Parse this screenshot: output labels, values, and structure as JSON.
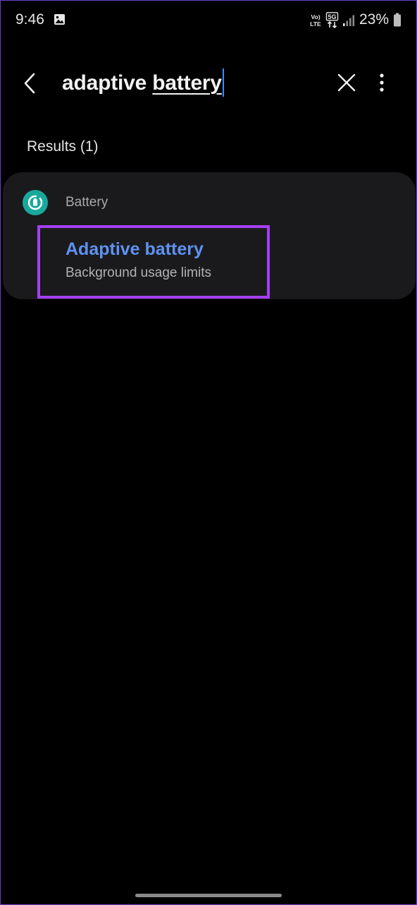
{
  "status_bar": {
    "time": "9:46",
    "gallery_icon": "image-icon",
    "volte_label": "Vo)) LTE",
    "network_label": "5G",
    "battery_percent": "23%"
  },
  "search": {
    "query_prefix": "adaptive ",
    "query_word": "battery",
    "back_icon": "chevron-left-icon",
    "clear_icon": "close-icon",
    "more_icon": "more-vertical-icon",
    "cursor_color": "#3e8cff"
  },
  "results": {
    "header": "Results (1)",
    "items": [
      {
        "category": "Battery",
        "category_icon": "battery-settings-icon",
        "category_icon_color": "#1aa89c",
        "title": "Adaptive battery",
        "subtitle": "Background usage limits",
        "title_color": "#5e92f1",
        "highlight_color": "#a540f2"
      }
    ]
  }
}
